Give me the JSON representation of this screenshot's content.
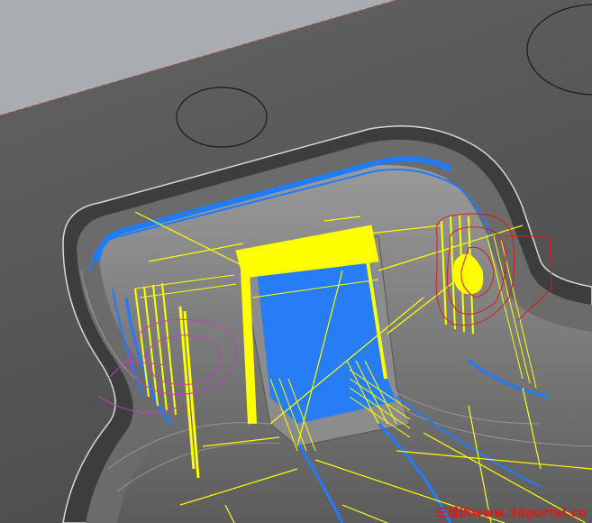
{
  "watermark": {
    "cn_text": "三维网",
    "url_text": "www.3dportal.cn",
    "cn_color": "#e01818",
    "url_color": "#e01818"
  },
  "colors": {
    "background_plane": "#a7aaae",
    "part_top_face": "#5b5b5b",
    "part_top_face_dark": "#4a4a4a",
    "cavity_floor": "#7c7c7c",
    "edge_highlight": "#d8d8d8",
    "toolpath_yellow": "#ffff00",
    "toolpath_blue": "#1e7cff",
    "toolpath_red": "#e01818",
    "toolpath_magenta": "#c040c0",
    "plane_edge_red": "#e05050"
  },
  "icons": {
    "cad_part": "3d-mold-cavity-part",
    "toolpath": "machining-toolpath-lines"
  }
}
